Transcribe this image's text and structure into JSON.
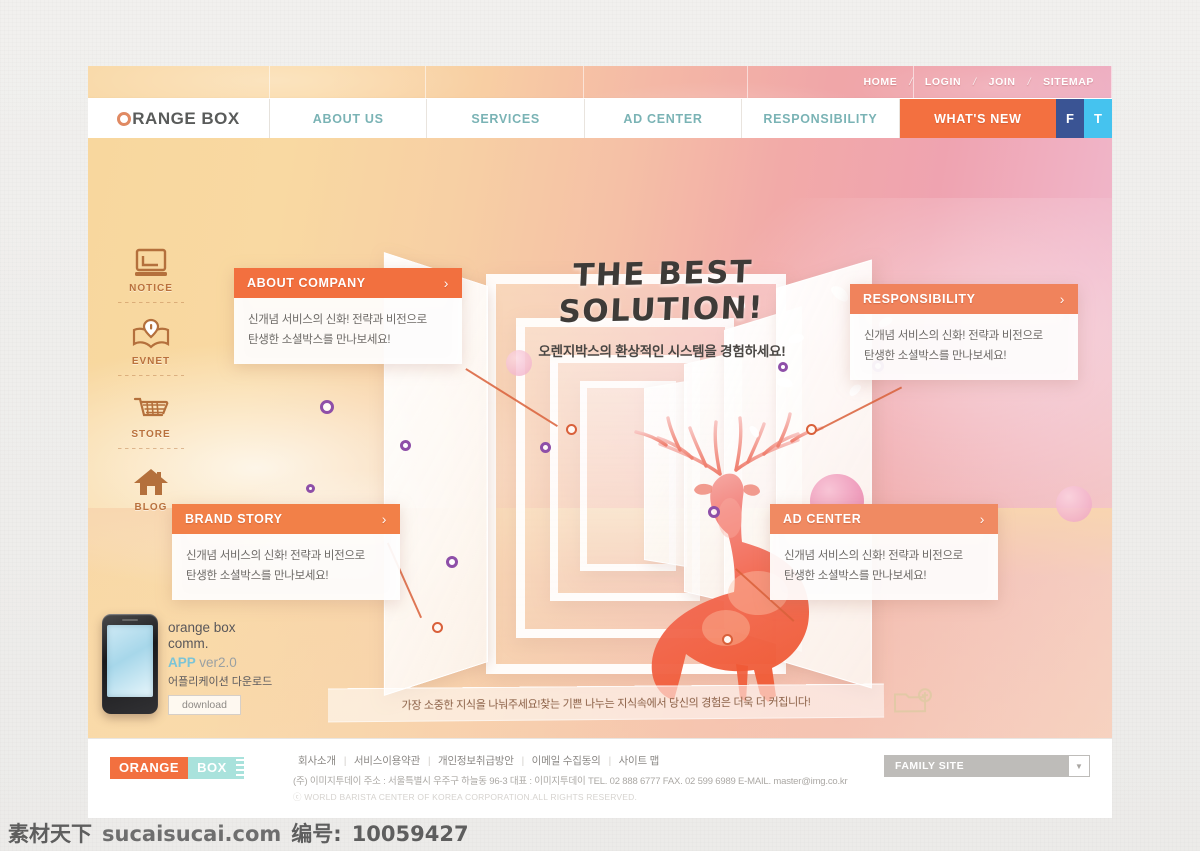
{
  "header": {
    "logo": {
      "first_letter": "O",
      "rest": "RANGE BOX"
    },
    "util_links": [
      "HOME",
      "LOGIN",
      "JOIN",
      "SITEMAP"
    ],
    "util_separator": "/",
    "nav_items": [
      {
        "label": "ABOUT US",
        "active": false
      },
      {
        "label": "SERVICES",
        "active": false
      },
      {
        "label": "AD CENTER",
        "active": false
      },
      {
        "label": "RESPONSIBILITY",
        "active": false
      },
      {
        "label": "WHAT'S NEW",
        "active": true
      }
    ],
    "social": [
      {
        "name": "facebook",
        "label": "F",
        "color": "#3a5494"
      },
      {
        "name": "twitter",
        "label": "T",
        "color": "#45c3ef"
      }
    ]
  },
  "rail": [
    {
      "label": "NOTICE",
      "icon": "monitor-icon"
    },
    {
      "label": "EVNET",
      "icon": "book-icon"
    },
    {
      "label": "STORE",
      "icon": "cart-icon"
    },
    {
      "label": "BLOG",
      "icon": "house-icon"
    }
  ],
  "hero": {
    "title": "THE BEST SOLUTION!",
    "subtitle": "오렌지박스의 환상적인 시스템을 경험하세요!"
  },
  "cards": {
    "about": {
      "title": "ABOUT COMPANY",
      "line1": "신개념 서비스의 신화! 전략과 비전으로",
      "line2": "탄생한 소셜박스를 만나보세요!",
      "chevron": "›"
    },
    "responsibility": {
      "title": "RESPONSIBILITY",
      "line1": "신개념 서비스의 신화! 전략과 비전으로",
      "line2": "탄생한 소셜박스를 만나보세요!",
      "chevron": "›"
    },
    "brand": {
      "title": "BRAND STORY",
      "line1": "신개념 서비스의 신화! 전략과 비전으로",
      "line2": "탄생한 소셜박스를 만나보세요!",
      "chevron": "›"
    },
    "adcenter": {
      "title": "AD CENTER",
      "line1": "신개념 서비스의 신화! 전략과 비전으로",
      "line2": "탄생한 소셜박스를 만나보세요!",
      "chevron": "›"
    }
  },
  "app_promo": {
    "line1": "orange box",
    "line2": "comm.",
    "app_label": "APP",
    "version": "ver2.0",
    "korean": "어플리케이션 다운로드",
    "download_label": "download"
  },
  "ribbon": {
    "text": "가장 소중한 지식을 나눠주세요!찾는 기쁜 나누는 지식속에서 당신의 경험은 더욱 더 커집니다!",
    "icon": "folder-add-icon"
  },
  "footer": {
    "logo_a": "ORANGE",
    "logo_b": "BOX",
    "links": [
      "회사소개",
      "서비스이용약관",
      "개인정보취급방안",
      "이메일 수집동의",
      "사이트 맵"
    ],
    "separator": "|",
    "address": "(주) 이미지투데이   주소 : 서울특별시 우주구 하늘동 96-3  대표 : 이미지투데이  TEL. 02 888 6777  FAX. 02 599 6989 E-MAIL. master@img.co.kr",
    "copyright": "ⓒ WORLD BARISTA CENTER OF KOREA CORPORATION.ALL RIGHTS RESERVED.",
    "family_site": {
      "label": "FAMILY SITE",
      "caret": "▼"
    }
  },
  "watermark": {
    "brand_cn": "素材天下",
    "domain": "sucaisucai.com",
    "id_label": "编号:",
    "id_value": "10059427"
  },
  "colors": {
    "accent_orange": "#f2703f",
    "nav_teal": "#7ab3b5",
    "mint": "#a9e2dc",
    "marker_purple": "#8e4fa8",
    "node_orange": "#d9603a"
  }
}
